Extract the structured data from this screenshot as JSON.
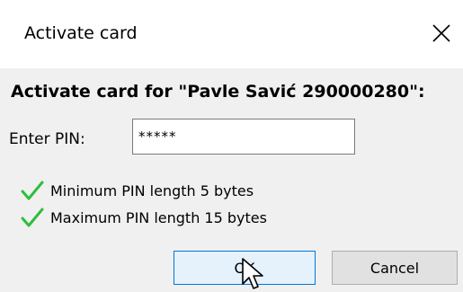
{
  "window": {
    "title": "Activate card",
    "close_icon": "close-icon"
  },
  "dialog": {
    "heading": "Activate card for \"Pavle Savić 290000280\":",
    "pin_label": "Enter PIN:",
    "pin_value": "*****",
    "rules": [
      {
        "icon": "checkmark-icon",
        "text": "Minimum PIN length 5 bytes"
      },
      {
        "icon": "checkmark-icon",
        "text": "Maximum PIN length 15 bytes"
      }
    ]
  },
  "buttons": {
    "ok_label": "OK",
    "cancel_label": "Cancel"
  },
  "colors": {
    "check_green": "#2dbe3c",
    "ok_border": "#0078d7",
    "ok_background": "#e5f1fb"
  }
}
